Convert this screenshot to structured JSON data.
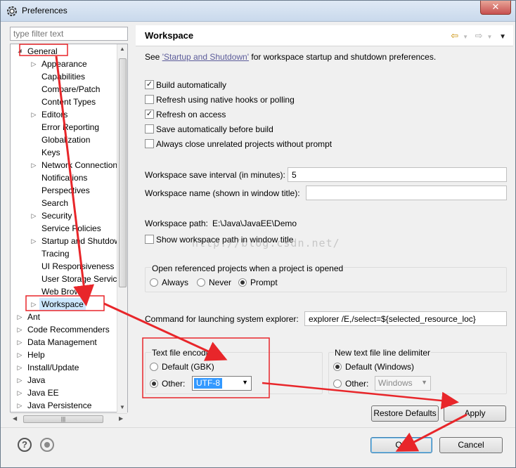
{
  "window": {
    "title": "Preferences"
  },
  "filter": {
    "placeholder": "type filter text"
  },
  "tree": {
    "items": [
      {
        "label": "General",
        "level": 1,
        "twisty": "expanded"
      },
      {
        "label": "Appearance",
        "level": 2,
        "twisty": "collapsed"
      },
      {
        "label": "Capabilities",
        "level": 2,
        "twisty": ""
      },
      {
        "label": "Compare/Patch",
        "level": 2,
        "twisty": ""
      },
      {
        "label": "Content Types",
        "level": 2,
        "twisty": ""
      },
      {
        "label": "Editors",
        "level": 2,
        "twisty": "collapsed"
      },
      {
        "label": "Error Reporting",
        "level": 2,
        "twisty": ""
      },
      {
        "label": "Globalization",
        "level": 2,
        "twisty": ""
      },
      {
        "label": "Keys",
        "level": 2,
        "twisty": ""
      },
      {
        "label": "Network Connection",
        "level": 2,
        "twisty": "collapsed"
      },
      {
        "label": "Notifications",
        "level": 2,
        "twisty": ""
      },
      {
        "label": "Perspectives",
        "level": 2,
        "twisty": ""
      },
      {
        "label": "Search",
        "level": 2,
        "twisty": ""
      },
      {
        "label": "Security",
        "level": 2,
        "twisty": "collapsed"
      },
      {
        "label": "Service Policies",
        "level": 2,
        "twisty": ""
      },
      {
        "label": "Startup and Shutdown",
        "level": 2,
        "twisty": "collapsed"
      },
      {
        "label": "Tracing",
        "level": 2,
        "twisty": ""
      },
      {
        "label": "UI Responsiveness M",
        "level": 2,
        "twisty": ""
      },
      {
        "label": "User Storage Service",
        "level": 2,
        "twisty": ""
      },
      {
        "label": "Web Browser",
        "level": 2,
        "twisty": ""
      },
      {
        "label": "Workspace",
        "level": 2,
        "twisty": "collapsed",
        "selected": true
      },
      {
        "label": "Ant",
        "level": 1,
        "twisty": "collapsed"
      },
      {
        "label": "Code Recommenders",
        "level": 1,
        "twisty": "collapsed"
      },
      {
        "label": "Data Management",
        "level": 1,
        "twisty": "collapsed"
      },
      {
        "label": "Help",
        "level": 1,
        "twisty": "collapsed"
      },
      {
        "label": "Install/Update",
        "level": 1,
        "twisty": "collapsed"
      },
      {
        "label": "Java",
        "level": 1,
        "twisty": "collapsed"
      },
      {
        "label": "Java EE",
        "level": 1,
        "twisty": "collapsed"
      },
      {
        "label": "Java Persistence",
        "level": 1,
        "twisty": "collapsed"
      }
    ]
  },
  "page": {
    "title": "Workspace",
    "see_prefix": "See ",
    "see_link": "'Startup and Shutdown'",
    "see_suffix": " for workspace startup and shutdown preferences.",
    "checkboxes": [
      {
        "label": "Build automatically",
        "checked": true
      },
      {
        "label": "Refresh using native hooks or polling",
        "checked": false
      },
      {
        "label": "Refresh on access",
        "checked": true
      },
      {
        "label": "Save automatically before build",
        "checked": false
      },
      {
        "label": "Always close unrelated projects without prompt",
        "checked": false
      }
    ],
    "save_interval_label": "Workspace save interval (in minutes):",
    "save_interval_value": "5",
    "ws_name_label": "Workspace name (shown in window title):",
    "ws_name_value": "",
    "ws_path_label": "Workspace path:",
    "ws_path_value": "E:\\Java\\JavaEE\\Demo",
    "show_path_label": "Show workspace path in window title",
    "open_projects_label": "Open referenced projects when a project is opened",
    "open_options": [
      {
        "label": "Always",
        "selected": false
      },
      {
        "label": "Never",
        "selected": false
      },
      {
        "label": "Prompt",
        "selected": true
      }
    ],
    "cmd_label": "Command for launching system explorer:",
    "cmd_value": "explorer /E,/select=${selected_resource_loc}",
    "encoding": {
      "title": "Text file encoding",
      "default_label": "Default (GBK)",
      "other_label": "Other:",
      "other_value": "UTF-8",
      "selected": "other"
    },
    "delimiter": {
      "title": "New text file line delimiter",
      "default_label": "Default (Windows)",
      "other_label": "Other:",
      "other_value": "Windows",
      "selected": "default"
    },
    "restore_label": "Restore Defaults",
    "apply_label": "Apply"
  },
  "footer": {
    "ok_label": "OK",
    "cancel_label": "Cancel",
    "help_icon": "question-icon",
    "import_icon": "record-icon"
  },
  "watermark": "http://blog.csdn.net/",
  "colors": {
    "annotation": "#e8262a",
    "link": "#5c5c9a",
    "selection": "#cde8ff"
  }
}
